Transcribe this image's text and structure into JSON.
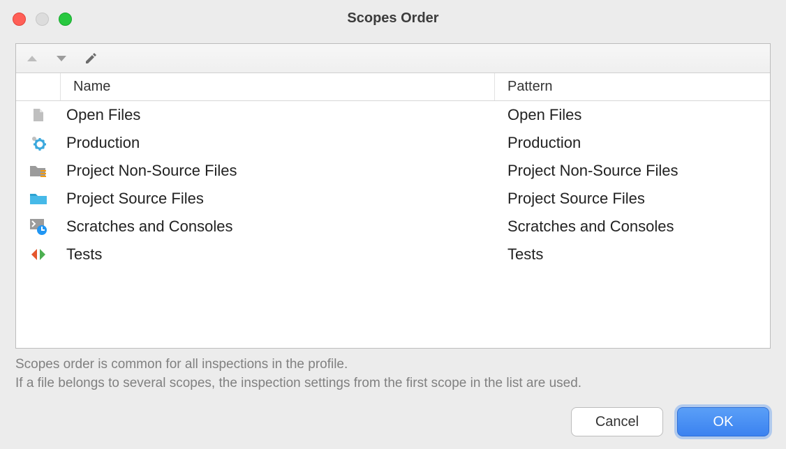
{
  "title": "Scopes Order",
  "toolbar": {
    "move_up": "Move Up",
    "move_down": "Move Down",
    "edit": "Edit"
  },
  "columns": {
    "name": "Name",
    "pattern": "Pattern"
  },
  "rows": [
    {
      "icon": "file-icon",
      "name": "Open Files",
      "pattern": "Open Files"
    },
    {
      "icon": "gear-icon",
      "name": "Production",
      "pattern": "Production"
    },
    {
      "icon": "folder-list-icon",
      "name": "Project Non-Source Files",
      "pattern": "Project Non-Source Files"
    },
    {
      "icon": "folder-icon",
      "name": "Project Source Files",
      "pattern": "Project Source Files"
    },
    {
      "icon": "console-clock-icon",
      "name": "Scratches and Consoles",
      "pattern": "Scratches and Consoles"
    },
    {
      "icon": "diff-icon",
      "name": "Tests",
      "pattern": "Tests"
    }
  ],
  "hint_line1": "Scopes order is common for all inspections in the profile.",
  "hint_line2": "If a file belongs to several scopes, the inspection settings from the first scope in the list are used.",
  "buttons": {
    "cancel": "Cancel",
    "ok": "OK"
  }
}
